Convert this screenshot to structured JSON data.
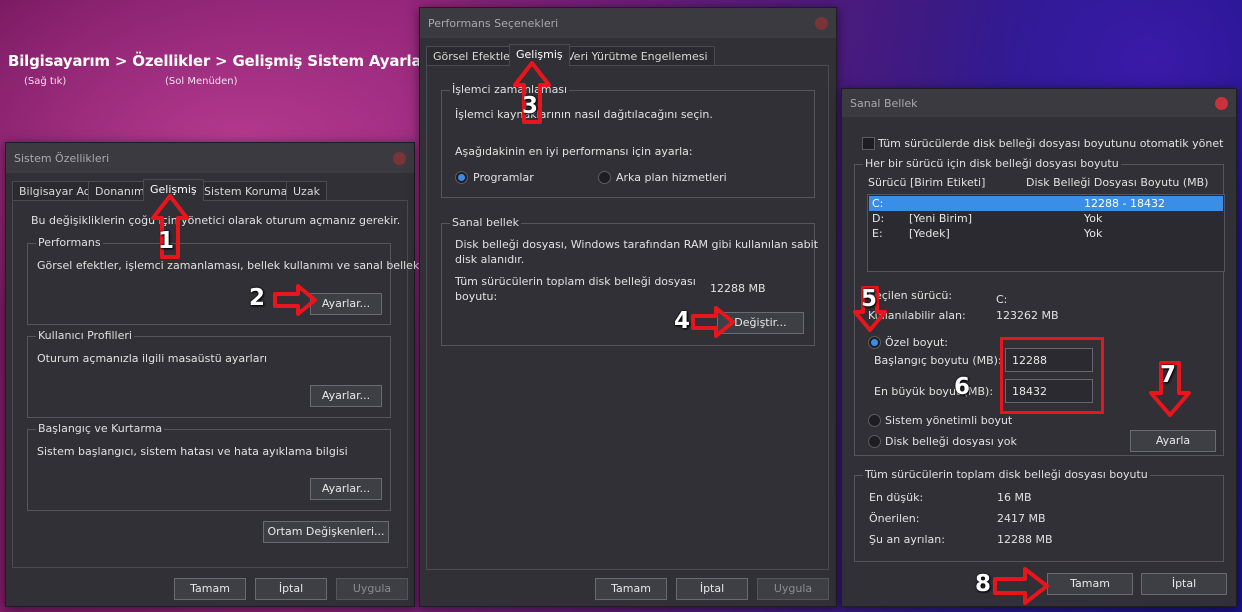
{
  "header": {
    "path": "Bilgisayarım > Özellikler > Gelişmiş Sistem Ayarları",
    "note_right_click": "(Sağ tık)",
    "note_left_menu": "(Sol Menüden)"
  },
  "sys_props": {
    "title": "Sistem Özellikleri",
    "tabs": [
      "Bilgisayar Adı",
      "Donanım",
      "Gelişmiş",
      "Sistem Koruması",
      "Uzak"
    ],
    "admin_note": "Bu değişikliklerin çoğu için yönetici olarak oturum açmanız gerekir.",
    "performance": {
      "label": "Performans",
      "desc": "Görsel efektler, işlemci zamanlaması, bellek kullanımı ve sanal bellek",
      "button": "Ayarlar..."
    },
    "profiles": {
      "label": "Kullanıcı Profilleri",
      "desc": "Oturum açmanızla ilgili masaüstü ayarları",
      "button": "Ayarlar..."
    },
    "startup": {
      "label": "Başlangıç ve Kurtarma",
      "desc": "Sistem başlangıcı, sistem hatası ve hata ayıklama bilgisi",
      "button": "Ayarlar..."
    },
    "env_button": "Ortam Değişkenleri...",
    "ok": "Tamam",
    "cancel": "İptal",
    "apply": "Uygula"
  },
  "perf": {
    "title": "Performans Seçenekleri",
    "tabs": [
      "Görsel Efektler",
      "Gelişmiş",
      "Veri Yürütme Engellemesi"
    ],
    "scheduling": {
      "label": "İşlemci zamanlaması",
      "desc": "İşlemci kaynaklarının nasıl dağıtılacağını seçin.",
      "prompt": "Aşağıdakinin en iyi performansı için ayarla:",
      "option_programs": "Programlar",
      "option_background": "Arka plan hizmetleri"
    },
    "vm": {
      "label": "Sanal bellek",
      "desc_line1": "Disk belleği dosyası, Windows tarafından RAM gibi kullanılan sabit",
      "desc_line2": "disk alanıdır.",
      "total_label_1": "Tüm sürücülerin toplam disk belleği dosyası",
      "total_label_2": "boyutu:",
      "total_value": "12288 MB",
      "button": "Değiştir..."
    },
    "ok": "Tamam",
    "cancel": "İptal",
    "apply": "Uygula"
  },
  "vmem": {
    "title": "Sanal Bellek",
    "auto_manage": "Tüm sürücülerde disk belleği dosyası boyutunu otomatik yönet",
    "per_drive_label": "Her bir sürücü için disk belleği dosyası boyutu",
    "col_drive": "Sürücü  [Birim Etiketi]",
    "col_size": "Disk Belleği Dosyası Boyutu (MB)",
    "drives": [
      {
        "drive": "C:",
        "label": "",
        "size": "12288 - 18432"
      },
      {
        "drive": "D:",
        "label": "[Yeni Birim]",
        "size": "Yok"
      },
      {
        "drive": "E:",
        "label": "[Yedek]",
        "size": "Yok"
      }
    ],
    "selected_drive_label": "Seçilen sürücü:",
    "selected_drive_value": "C:",
    "available_label": "Kullanılabilir alan:",
    "available_value": "123262 MB",
    "custom_size": "Özel boyut:",
    "initial_label": "Başlangıç boyutu (MB):",
    "initial_value": "12288",
    "max_label": "En büyük boyut (MB):",
    "max_value": "18432",
    "system_managed": "Sistem yönetimli boyut",
    "no_paging": "Disk belleği dosyası yok",
    "set_button": "Ayarla",
    "total_group_label": "Tüm sürücülerin toplam disk belleği dosyası boyutu",
    "min_label": "En düşük:",
    "min_value": "16 MB",
    "recommended_label": "Önerilen:",
    "recommended_value": "2417 MB",
    "current_label": "Şu an ayrılan:",
    "current_value": "12288 MB",
    "ok": "Tamam",
    "cancel": "İptal"
  },
  "steps": [
    "1",
    "2",
    "3",
    "4",
    "5",
    "6",
    "7",
    "8"
  ],
  "colors": {
    "annotation_red": "#e8151c",
    "accent_blue": "#3a8ee6",
    "close_red": "#c8323c"
  }
}
